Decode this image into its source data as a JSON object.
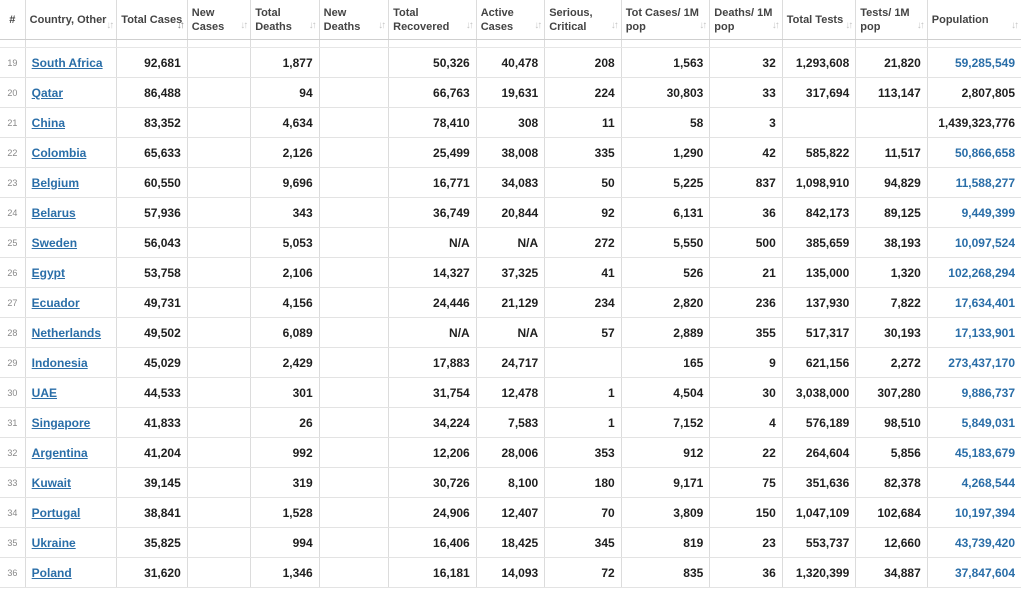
{
  "columns": [
    {
      "key": "idx",
      "label": "#",
      "sortable": false
    },
    {
      "key": "country",
      "label": "Country, Other",
      "sortable": true
    },
    {
      "key": "total_cases",
      "label": "Total Cases",
      "sortable": true,
      "active": true
    },
    {
      "key": "new_cases",
      "label": "New Cases",
      "sortable": true
    },
    {
      "key": "total_deaths",
      "label": "Total Deaths",
      "sortable": true
    },
    {
      "key": "new_deaths",
      "label": "New Deaths",
      "sortable": true
    },
    {
      "key": "total_recovered",
      "label": "Total Recovered",
      "sortable": true
    },
    {
      "key": "active_cases",
      "label": "Active Cases",
      "sortable": true
    },
    {
      "key": "serious",
      "label": "Serious, Critical",
      "sortable": true
    },
    {
      "key": "cases_per_1m",
      "label": "Tot Cases/ 1M pop",
      "sortable": true
    },
    {
      "key": "deaths_per_1m",
      "label": "Deaths/ 1M pop",
      "sortable": true
    },
    {
      "key": "total_tests",
      "label": "Total Tests",
      "sortable": true
    },
    {
      "key": "tests_per_1m",
      "label": "Tests/ 1M pop",
      "sortable": true
    },
    {
      "key": "population",
      "label": "Population",
      "sortable": true
    }
  ],
  "sort_icon": "↓↑",
  "rows": [
    {
      "idx": "19",
      "country": "South Africa",
      "total_cases": "92,681",
      "new_cases": "",
      "total_deaths": "1,877",
      "new_deaths": "",
      "total_recovered": "50,326",
      "active_cases": "40,478",
      "serious": "208",
      "cases_per_1m": "1,563",
      "deaths_per_1m": "32",
      "total_tests": "1,293,608",
      "tests_per_1m": "21,820",
      "population": "59,285,549",
      "population_link": true
    },
    {
      "idx": "20",
      "country": "Qatar",
      "total_cases": "86,488",
      "new_cases": "",
      "total_deaths": "94",
      "new_deaths": "",
      "total_recovered": "66,763",
      "active_cases": "19,631",
      "serious": "224",
      "cases_per_1m": "30,803",
      "deaths_per_1m": "33",
      "total_tests": "317,694",
      "tests_per_1m": "113,147",
      "population": "2,807,805",
      "population_link": false
    },
    {
      "idx": "21",
      "country": "China",
      "total_cases": "83,352",
      "new_cases": "",
      "total_deaths": "4,634",
      "new_deaths": "",
      "total_recovered": "78,410",
      "active_cases": "308",
      "serious": "11",
      "cases_per_1m": "58",
      "deaths_per_1m": "3",
      "total_tests": "",
      "tests_per_1m": "",
      "population": "1,439,323,776",
      "population_link": false
    },
    {
      "idx": "22",
      "country": "Colombia",
      "total_cases": "65,633",
      "new_cases": "",
      "total_deaths": "2,126",
      "new_deaths": "",
      "total_recovered": "25,499",
      "active_cases": "38,008",
      "serious": "335",
      "cases_per_1m": "1,290",
      "deaths_per_1m": "42",
      "total_tests": "585,822",
      "tests_per_1m": "11,517",
      "population": "50,866,658",
      "population_link": true
    },
    {
      "idx": "23",
      "country": "Belgium",
      "total_cases": "60,550",
      "new_cases": "",
      "total_deaths": "9,696",
      "new_deaths": "",
      "total_recovered": "16,771",
      "active_cases": "34,083",
      "serious": "50",
      "cases_per_1m": "5,225",
      "deaths_per_1m": "837",
      "total_tests": "1,098,910",
      "tests_per_1m": "94,829",
      "population": "11,588,277",
      "population_link": true
    },
    {
      "idx": "24",
      "country": "Belarus",
      "total_cases": "57,936",
      "new_cases": "",
      "total_deaths": "343",
      "new_deaths": "",
      "total_recovered": "36,749",
      "active_cases": "20,844",
      "serious": "92",
      "cases_per_1m": "6,131",
      "deaths_per_1m": "36",
      "total_tests": "842,173",
      "tests_per_1m": "89,125",
      "population": "9,449,399",
      "population_link": true
    },
    {
      "idx": "25",
      "country": "Sweden",
      "total_cases": "56,043",
      "new_cases": "",
      "total_deaths": "5,053",
      "new_deaths": "",
      "total_recovered": "N/A",
      "active_cases": "N/A",
      "serious": "272",
      "cases_per_1m": "5,550",
      "deaths_per_1m": "500",
      "total_tests": "385,659",
      "tests_per_1m": "38,193",
      "population": "10,097,524",
      "population_link": true
    },
    {
      "idx": "26",
      "country": "Egypt",
      "total_cases": "53,758",
      "new_cases": "",
      "total_deaths": "2,106",
      "new_deaths": "",
      "total_recovered": "14,327",
      "active_cases": "37,325",
      "serious": "41",
      "cases_per_1m": "526",
      "deaths_per_1m": "21",
      "total_tests": "135,000",
      "tests_per_1m": "1,320",
      "population": "102,268,294",
      "population_link": true
    },
    {
      "idx": "27",
      "country": "Ecuador",
      "total_cases": "49,731",
      "new_cases": "",
      "total_deaths": "4,156",
      "new_deaths": "",
      "total_recovered": "24,446",
      "active_cases": "21,129",
      "serious": "234",
      "cases_per_1m": "2,820",
      "deaths_per_1m": "236",
      "total_tests": "137,930",
      "tests_per_1m": "7,822",
      "population": "17,634,401",
      "population_link": true
    },
    {
      "idx": "28",
      "country": "Netherlands",
      "total_cases": "49,502",
      "new_cases": "",
      "total_deaths": "6,089",
      "new_deaths": "",
      "total_recovered": "N/A",
      "active_cases": "N/A",
      "serious": "57",
      "cases_per_1m": "2,889",
      "deaths_per_1m": "355",
      "total_tests": "517,317",
      "tests_per_1m": "30,193",
      "population": "17,133,901",
      "population_link": true
    },
    {
      "idx": "29",
      "country": "Indonesia",
      "total_cases": "45,029",
      "new_cases": "",
      "total_deaths": "2,429",
      "new_deaths": "",
      "total_recovered": "17,883",
      "active_cases": "24,717",
      "serious": "",
      "cases_per_1m": "165",
      "deaths_per_1m": "9",
      "total_tests": "621,156",
      "tests_per_1m": "2,272",
      "population": "273,437,170",
      "population_link": true
    },
    {
      "idx": "30",
      "country": "UAE",
      "total_cases": "44,533",
      "new_cases": "",
      "total_deaths": "301",
      "new_deaths": "",
      "total_recovered": "31,754",
      "active_cases": "12,478",
      "serious": "1",
      "cases_per_1m": "4,504",
      "deaths_per_1m": "30",
      "total_tests": "3,038,000",
      "tests_per_1m": "307,280",
      "population": "9,886,737",
      "population_link": true
    },
    {
      "idx": "31",
      "country": "Singapore",
      "total_cases": "41,833",
      "new_cases": "",
      "total_deaths": "26",
      "new_deaths": "",
      "total_recovered": "34,224",
      "active_cases": "7,583",
      "serious": "1",
      "cases_per_1m": "7,152",
      "deaths_per_1m": "4",
      "total_tests": "576,189",
      "tests_per_1m": "98,510",
      "population": "5,849,031",
      "population_link": true
    },
    {
      "idx": "32",
      "country": "Argentina",
      "total_cases": "41,204",
      "new_cases": "",
      "total_deaths": "992",
      "new_deaths": "",
      "total_recovered": "12,206",
      "active_cases": "28,006",
      "serious": "353",
      "cases_per_1m": "912",
      "deaths_per_1m": "22",
      "total_tests": "264,604",
      "tests_per_1m": "5,856",
      "population": "45,183,679",
      "population_link": true
    },
    {
      "idx": "33",
      "country": "Kuwait",
      "total_cases": "39,145",
      "new_cases": "",
      "total_deaths": "319",
      "new_deaths": "",
      "total_recovered": "30,726",
      "active_cases": "8,100",
      "serious": "180",
      "cases_per_1m": "9,171",
      "deaths_per_1m": "75",
      "total_tests": "351,636",
      "tests_per_1m": "82,378",
      "population": "4,268,544",
      "population_link": true
    },
    {
      "idx": "34",
      "country": "Portugal",
      "total_cases": "38,841",
      "new_cases": "",
      "total_deaths": "1,528",
      "new_deaths": "",
      "total_recovered": "24,906",
      "active_cases": "12,407",
      "serious": "70",
      "cases_per_1m": "3,809",
      "deaths_per_1m": "150",
      "total_tests": "1,047,109",
      "tests_per_1m": "102,684",
      "population": "10,197,394",
      "population_link": true
    },
    {
      "idx": "35",
      "country": "Ukraine",
      "total_cases": "35,825",
      "new_cases": "",
      "total_deaths": "994",
      "new_deaths": "",
      "total_recovered": "16,406",
      "active_cases": "18,425",
      "serious": "345",
      "cases_per_1m": "819",
      "deaths_per_1m": "23",
      "total_tests": "553,737",
      "tests_per_1m": "12,660",
      "population": "43,739,420",
      "population_link": true
    },
    {
      "idx": "36",
      "country": "Poland",
      "total_cases": "31,620",
      "new_cases": "",
      "total_deaths": "1,346",
      "new_deaths": "",
      "total_recovered": "16,181",
      "active_cases": "14,093",
      "serious": "72",
      "cases_per_1m": "835",
      "deaths_per_1m": "36",
      "total_tests": "1,320,399",
      "tests_per_1m": "34,887",
      "population": "37,847,604",
      "population_link": true
    }
  ],
  "colors": {
    "link": "#2a6ea8",
    "text": "#1f1f1f",
    "grid": "#dcdcdc"
  }
}
